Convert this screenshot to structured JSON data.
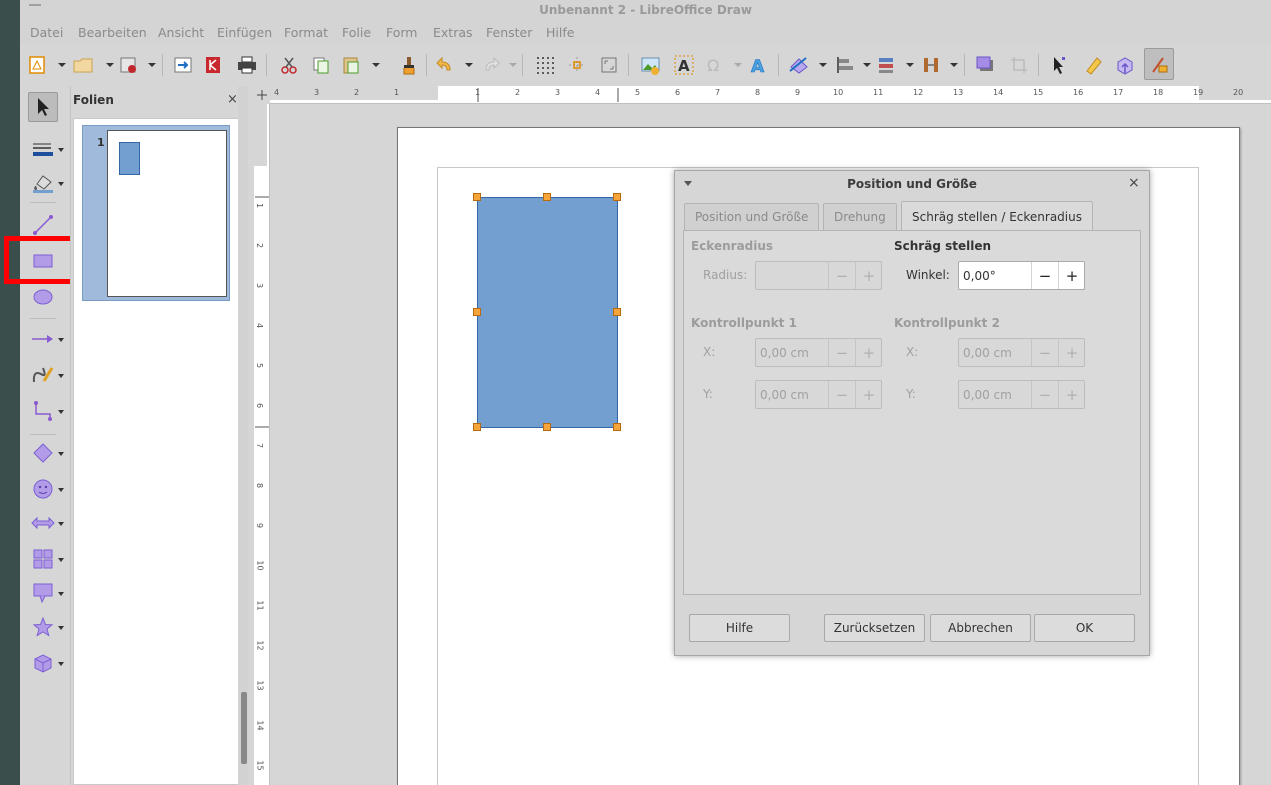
{
  "window": {
    "title": "Unbenannt 2 - LibreOffice Draw"
  },
  "menu": [
    "Datei",
    "Bearbeiten",
    "Ansicht",
    "Einfügen",
    "Format",
    "Folie",
    "Form",
    "Extras",
    "Fenster",
    "Hilfe"
  ],
  "slide_pane": {
    "title": "Folien",
    "close": "×",
    "slide_number": "1"
  },
  "rulers": {
    "horizontal": [
      "4",
      "3",
      "2",
      "1",
      "1",
      "2",
      "3",
      "4",
      "5",
      "6",
      "7",
      "8",
      "9",
      "10",
      "11",
      "12",
      "13",
      "14",
      "15",
      "16",
      "17",
      "18",
      "19",
      "20"
    ],
    "vertical": [
      "1",
      "2",
      "3",
      "4",
      "5",
      "6",
      "7",
      "8",
      "9",
      "10",
      "11",
      "12",
      "13",
      "14",
      "15"
    ]
  },
  "dialog": {
    "title": "Position und Größe",
    "close": "×",
    "tabs": [
      "Position und Größe",
      "Drehung",
      "Schräg stellen / Eckenradius"
    ],
    "active_tab": "Schräg stellen / Eckenradius",
    "corner_radius": {
      "heading": "Eckenradius",
      "radius_label": "Radius:",
      "radius_value": ""
    },
    "slant": {
      "heading": "Schräg stellen",
      "angle_label": "Winkel:",
      "angle_value": "0,00°"
    },
    "control_point_1": {
      "heading": "Kontrollpunkt 1",
      "x_label": "X:",
      "x_value": "0,00 cm",
      "y_label": "Y:",
      "y_value": "0,00 cm"
    },
    "control_point_2": {
      "heading": "Kontrollpunkt 2",
      "x_label": "X:",
      "x_value": "0,00 cm",
      "y_label": "Y:",
      "y_value": "0,00 cm"
    },
    "spin_minus": "−",
    "spin_plus": "+",
    "buttons": {
      "help": "Hilfe",
      "reset": "Zurücksetzen",
      "cancel": "Abbrechen",
      "ok": "OK"
    }
  },
  "colors": {
    "shape_fill": "#729fcf",
    "shape_border": "#3465a4",
    "handle": "#f7a43b",
    "highlight": "#ff0000",
    "slide_selection": "#9fbadb"
  }
}
